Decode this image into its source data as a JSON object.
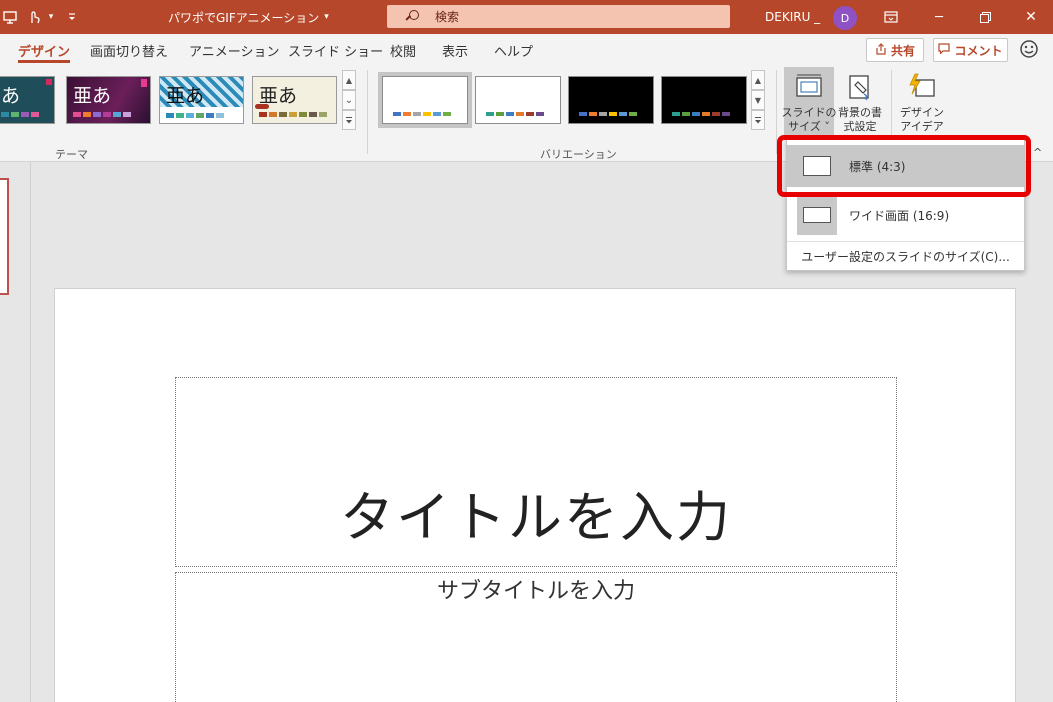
{
  "titlebar": {
    "doc_title": "パワポでGIFアニメーション",
    "search_label": "検索",
    "user_name": "DEKIRU _",
    "avatar_initial": "D",
    "minimize_glyph": "─",
    "restore_glyph": "❐",
    "close_glyph": "✕",
    "ribbon_display_glyph": "⊟",
    "qat_glyph": "▾",
    "colors": {
      "bar": "#b7472a",
      "search": "#f4c4b0",
      "avatar": "#8f52c5"
    }
  },
  "tabs": [
    {
      "label": "デザイン",
      "active": true
    },
    {
      "label": "画面切り替え"
    },
    {
      "label": "アニメーション"
    },
    {
      "label": "スライド ショー"
    },
    {
      "label": "校閲"
    },
    {
      "label": "表示"
    },
    {
      "label": "ヘルプ"
    }
  ],
  "actions": {
    "share_label": "共有",
    "comment_label": "コメント",
    "share_icon": "share-icon",
    "comment_icon": "comment-icon",
    "smiley_icon": "smiley-icon"
  },
  "ribbon": {
    "themes_label": "テーマ",
    "variations_label": "バリエーション",
    "theme_text": "亜あ",
    "theme_text_partial": "あ",
    "slide_size_label_1": "スライドの",
    "slide_size_label_2": "サイズ ˅",
    "bg_format_label_1": "背景の書",
    "bg_format_label_2": "式設定",
    "design_ideas_label_1": "デザイン",
    "design_ideas_label_2": "アイデア"
  },
  "menu": {
    "items": [
      {
        "label": "標準 (4:3)",
        "icon": "aspect-4-3-icon",
        "highlighted": true
      },
      {
        "label": "ワイド画面 (16:9)",
        "icon": "aspect-16-9-icon",
        "selected": true
      },
      {
        "label": "ユーザー設定のスライドのサイズ(C)..."
      }
    ]
  },
  "slide": {
    "title_placeholder": "タイトルを入力",
    "subtitle_placeholder": "サブタイトルを入力"
  },
  "collapse_glyph": "^"
}
